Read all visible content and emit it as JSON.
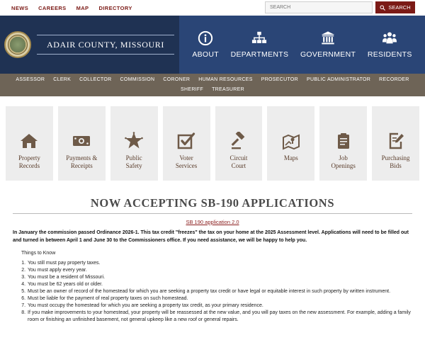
{
  "utility": {
    "links": [
      "NEWS",
      "CAREERS",
      "MAP",
      "DIRECTORY"
    ],
    "search_placeholder": "SEARCH",
    "search_button": "SEARCH"
  },
  "header": {
    "county_name": "ADAIR COUNTY, MISSOURI",
    "main_nav": [
      {
        "label": "ABOUT",
        "icon": "info-icon"
      },
      {
        "label": "DEPARTMENTS",
        "icon": "org-chart-icon"
      },
      {
        "label": "GOVERNMENT",
        "icon": "building-icon"
      },
      {
        "label": "RESIDENTS",
        "icon": "people-icon"
      }
    ]
  },
  "sub_nav": [
    "ASSESSOR",
    "CLERK",
    "COLLECTOR",
    "COMMISSION",
    "CORONER",
    "HUMAN RESOURCES",
    "PROSECUTOR",
    "PUBLIC ADMINISTRATOR",
    "RECORDER",
    "SHERIFF",
    "TREASURER"
  ],
  "quick_links": [
    {
      "line1": "Property",
      "line2": "Records",
      "icon": "house-icon"
    },
    {
      "line1": "Payments &",
      "line2": "Receipts",
      "icon": "money-icon"
    },
    {
      "line1": "Public",
      "line2": "Safety",
      "icon": "badge-star-icon"
    },
    {
      "line1": "Voter",
      "line2": "Services",
      "icon": "checkbox-icon"
    },
    {
      "line1": "Circuit",
      "line2": "Court",
      "icon": "gavel-icon"
    },
    {
      "line1": "Maps",
      "line2": "",
      "icon": "map-icon"
    },
    {
      "line1": "Job",
      "line2": "Openings",
      "icon": "clipboard-icon"
    },
    {
      "line1": "Purchasing",
      "line2": "Bids",
      "icon": "edit-document-icon"
    }
  ],
  "content": {
    "heading": "NOW ACCEPTING SB-190 APPLICATIONS",
    "app_link": "SB 190 application 2.0",
    "intro": "In January the commission passed Ordinance 2026-1.  This tax credit \"freezes\" the tax on your home at the 2025 Assessment level.  Applications will need to be filled out and turned in between April 1 and June 30 to the Commissioners office.  If you need assistance, we will be happy to help you.",
    "things_title": "Things to Know",
    "things": [
      "You still must pay property taxes.",
      "You must apply every year.",
      "You must be a resident of Missouri.",
      "You must be 62 years old or older.",
      "Must be an owner of record of the homestead for which you are seeking a property tax credit or have legal or equitable interest in such property by written instrument.",
      "Must be liable for the payment of real property taxes on such homestead.",
      "You must occupy the homestead for which you are seeking a property tax credit, as your primary residence.",
      "If you make improvements to your homestead, your property will be reassessed at the new value, and you will pay taxes on the new assessment.  For example, adding a family room or finishing an unfinished basement, not general upkeep like a new roof or general repairs."
    ]
  },
  "colors": {
    "utility_link": "#7b1a16",
    "header_left": "#1f3253",
    "header_right": "#2a4576",
    "sub_nav": "#6e6457",
    "tile_bg": "#ededed",
    "icon_brown": "#6e5a48"
  }
}
